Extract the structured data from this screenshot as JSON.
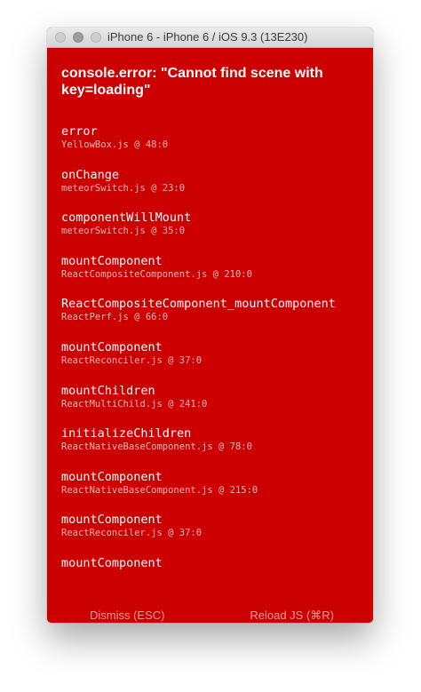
{
  "window": {
    "title": "iPhone 6 - iPhone 6 / iOS 9.3 (13E230)"
  },
  "error": {
    "message": "console.error: \"Cannot find scene with key=loading\""
  },
  "stack": [
    {
      "method": "error",
      "file": "YellowBox.js @ 48:0"
    },
    {
      "method": "onChange",
      "file": "meteorSwitch.js @ 23:0"
    },
    {
      "method": "componentWillMount",
      "file": "meteorSwitch.js @ 35:0"
    },
    {
      "method": "mountComponent",
      "file": "ReactCompositeComponent.js @ 210:0"
    },
    {
      "method": "ReactCompositeComponent_mountComponent",
      "file": "ReactPerf.js @ 66:0"
    },
    {
      "method": "mountComponent",
      "file": "ReactReconciler.js @ 37:0"
    },
    {
      "method": "mountChildren",
      "file": "ReactMultiChild.js @ 241:0"
    },
    {
      "method": "initializeChildren",
      "file": "ReactNativeBaseComponent.js @ 78:0"
    },
    {
      "method": "mountComponent",
      "file": "ReactNativeBaseComponent.js @ 215:0"
    },
    {
      "method": "mountComponent",
      "file": "ReactReconciler.js @ 37:0"
    },
    {
      "method": "mountComponent",
      "file": ""
    }
  ],
  "footer": {
    "dismiss_label": "Dismiss (ESC)",
    "reload_label": "Reload JS (⌘R)"
  },
  "colors": {
    "background": "#cc0000",
    "text": "#ffffff",
    "muted_text": "#e99a9a"
  }
}
